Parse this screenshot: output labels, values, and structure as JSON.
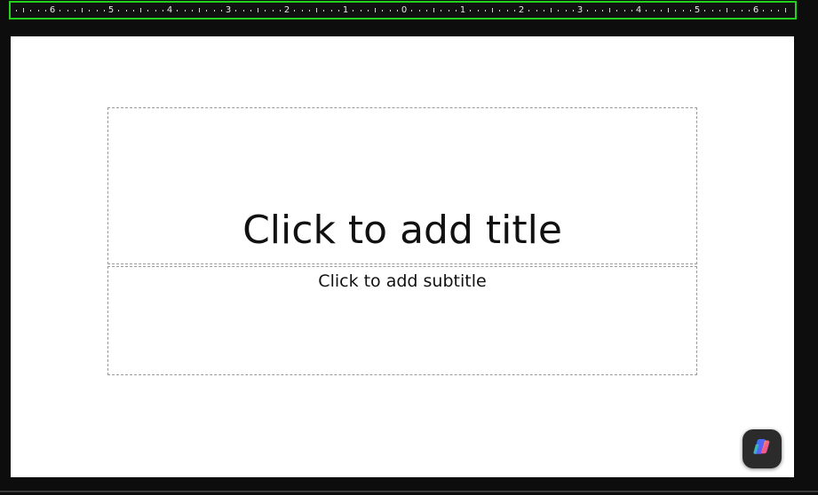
{
  "ruler": {
    "labels": [
      "6",
      "5",
      "4",
      "3",
      "2",
      "1",
      "0",
      "1",
      "2",
      "3",
      "4",
      "5",
      "6"
    ]
  },
  "slide": {
    "title_placeholder": "Click to add title",
    "subtitle_placeholder": "Click to add subtitle"
  },
  "copilot": {
    "icon": "copilot-icon"
  },
  "colors": {
    "ruler_highlight": "#23d11e",
    "background": "#0d0d0d",
    "slide": "#ffffff"
  }
}
